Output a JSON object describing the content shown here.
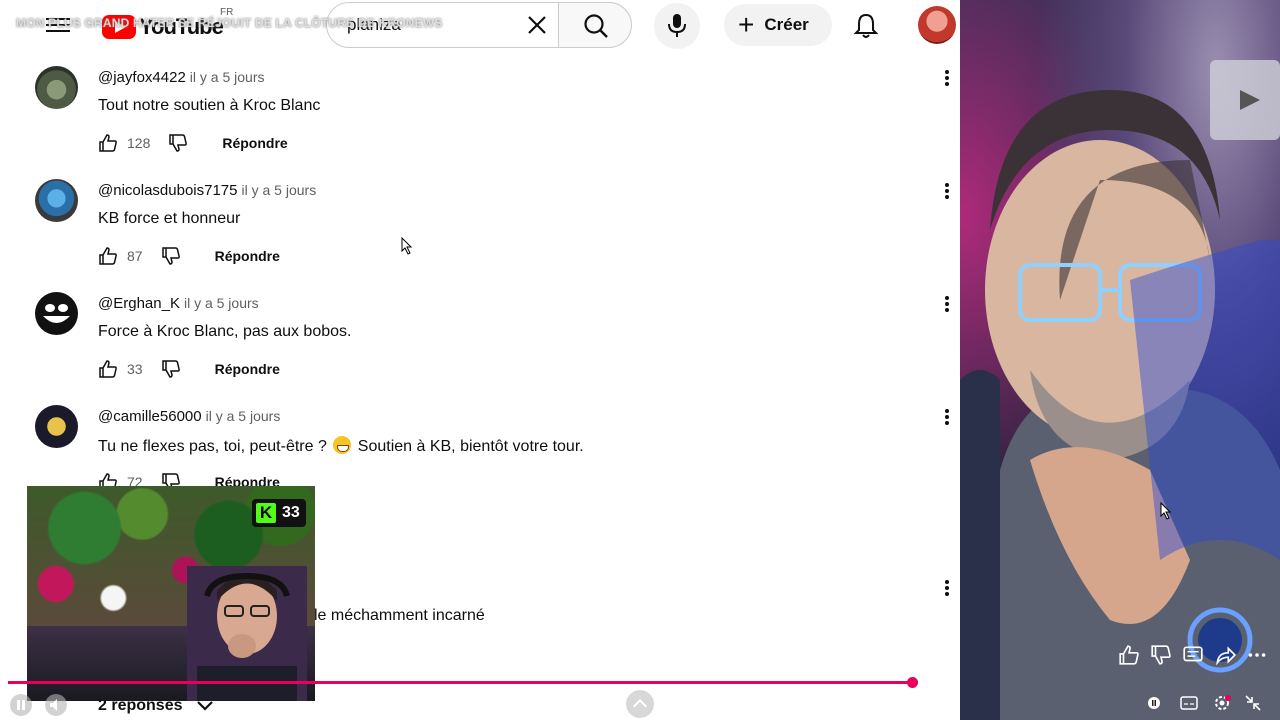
{
  "ticker": "MON PLUS GRAND HATER SE RÉJOUIT DE LA CLÔTURE DE KRONEWS",
  "header": {
    "logo_text": "YouTube",
    "country": "FR",
    "search_query": "planiza",
    "create_label": "Créer",
    "icons": [
      "menu-icon",
      "clear-icon",
      "search-icon",
      "mic-icon",
      "plus-icon",
      "bell-icon"
    ]
  },
  "comments": [
    {
      "handle": "@jayfox4422",
      "time": "il y a 5 jours",
      "text": "Tout notre soutien à Kroc Blanc",
      "likes": "128",
      "reply": "Répondre",
      "avatar_color": "#6b7b5a"
    },
    {
      "handle": "@nicolasdubois7175",
      "time": "il y a 5 jours",
      "text": "KB force et honneur",
      "likes": "87",
      "reply": "Répondre",
      "avatar_color": "#2a6fa8"
    },
    {
      "handle": "@Erghan_K",
      "time": "il y a 5 jours",
      "text": "Force à Kroc Blanc, pas aux bobos.",
      "likes": "33",
      "reply": "Répondre",
      "avatar_color": "#111111"
    },
    {
      "handle": "@camille56000",
      "time": "il y a 5 jours",
      "text_before": "Tu ne flexes pas, toi, peut-être ?",
      "text_after": "Soutien à KB, bientôt votre tour.",
      "likes": "72",
      "reply": "Répondre",
      "avatar_color": "#1a1a2a"
    }
  ],
  "partial_comment_text": "le méchamment incarné",
  "replies_label": "2 réponses",
  "cam": {
    "kick_count": "33",
    "kick_letter": "K",
    "accent": "#53fc18"
  },
  "player": {
    "progress_fraction": 0.918,
    "accent": "#e8005a"
  }
}
